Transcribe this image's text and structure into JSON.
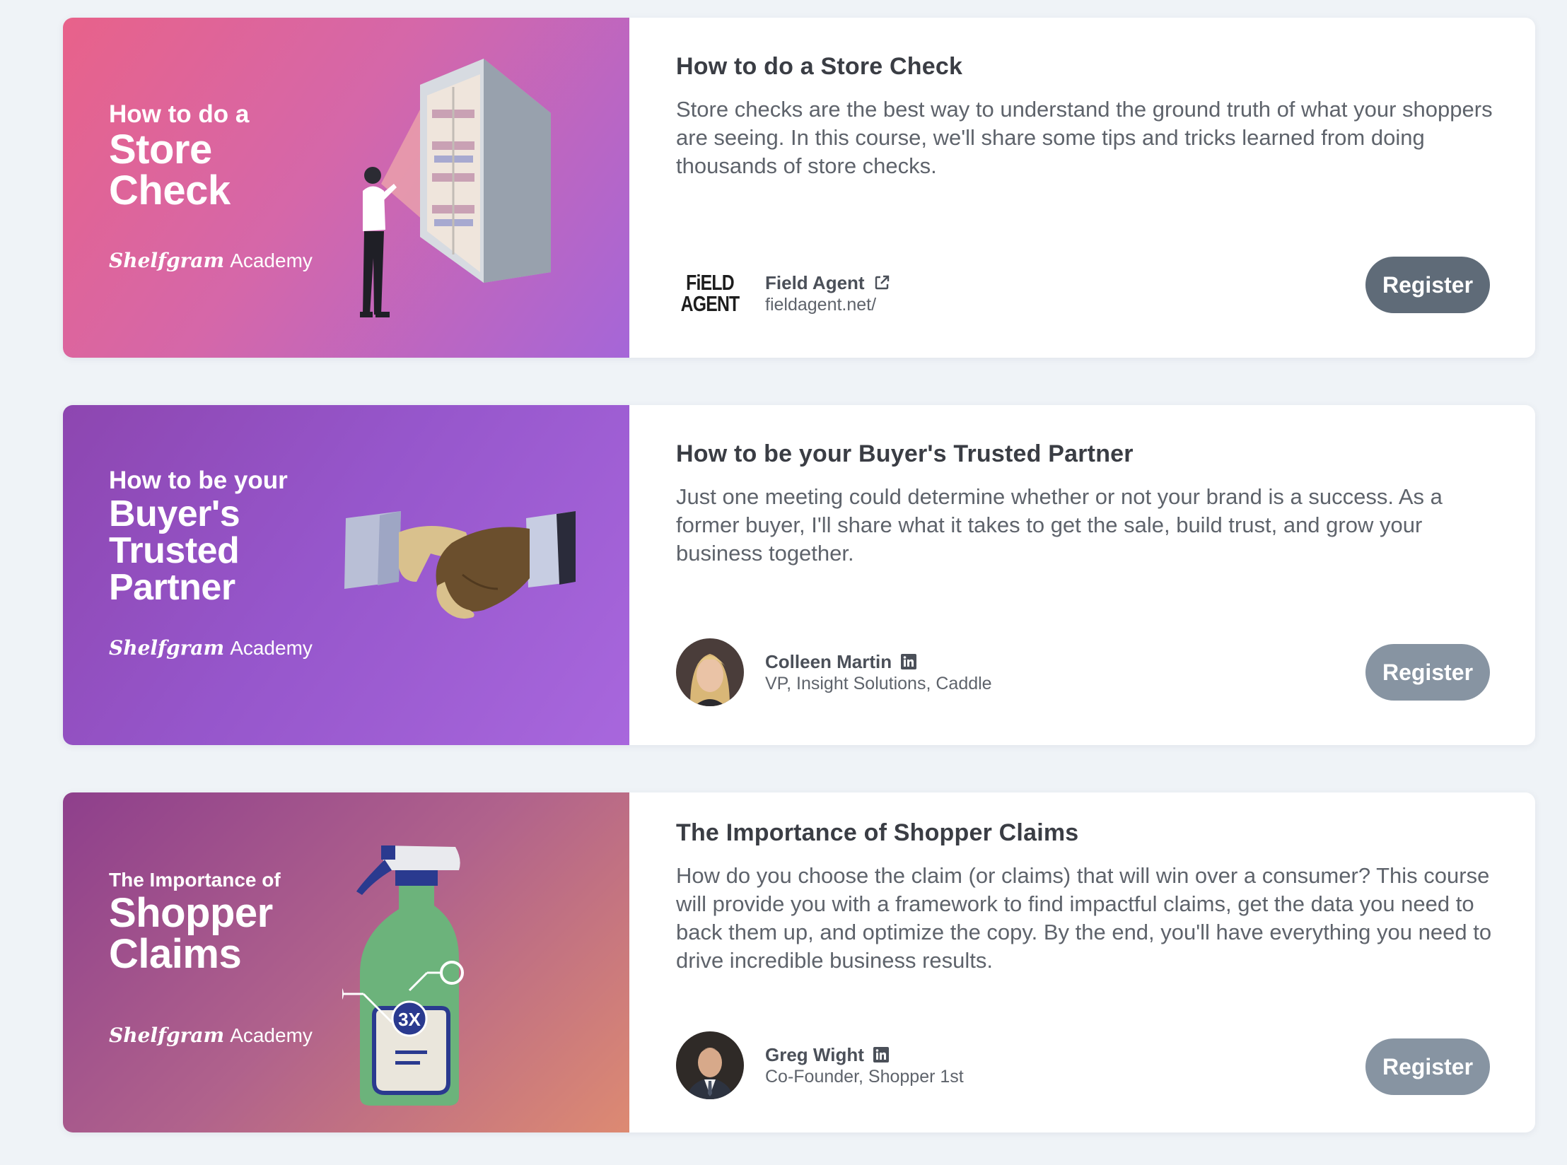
{
  "courses": [
    {
      "thumb": {
        "small_line": "How to do a",
        "big_line_1": "Store",
        "big_line_2": "Check",
        "big_line_3": "",
        "academy_brand": "Shelfgram",
        "academy_word": "Academy"
      },
      "title": "How to do a Store Check",
      "description": "Store checks are the best way to understand the ground truth of what your shoppers are seeing. In this course, we'll share some tips and tricks learned from doing thousands of store checks.",
      "presenter": {
        "logo_line_1": "FiELD",
        "logo_line_2": "AGENT",
        "name": "Field Agent",
        "name_icon": "external-link-icon",
        "subtitle": "fieldagent.net/"
      },
      "register_label": "Register"
    },
    {
      "thumb": {
        "small_line": "How to be your",
        "big_line_1": "Buyer's",
        "big_line_2": "Trusted",
        "big_line_3": "Partner",
        "academy_brand": "Shelfgram",
        "academy_word": "Academy"
      },
      "title": "How to be your Buyer's Trusted Partner",
      "description": "Just one meeting could determine whether or not your brand is a success. As a former buyer, I'll share what it takes to get the sale, build trust, and grow your business together.",
      "presenter": {
        "name": "Colleen Martin",
        "name_icon": "linkedin-icon",
        "subtitle": "VP, Insight Solutions, Caddle"
      },
      "register_label": "Register"
    },
    {
      "thumb": {
        "small_line": "The Importance of",
        "big_line_1": "Shopper",
        "big_line_2": "Claims",
        "big_line_3": "",
        "badge": "3X",
        "academy_brand": "Shelfgram",
        "academy_word": "Academy"
      },
      "title": "The Importance of Shopper Claims",
      "description": "How do you choose the claim (or claims) that will win over a consumer? This course will provide you with a framework to find impactful claims, get the data you need to back them up, and optimize the copy. By the end, you'll have everything you need to drive incredible business results.",
      "presenter": {
        "name": "Greg Wight",
        "name_icon": "linkedin-icon",
        "subtitle": "Co-Founder, Shopper 1st"
      },
      "register_label": "Register"
    }
  ],
  "colors": {
    "page_bg": "#eff3f7",
    "register_active": "#5f6b78",
    "register_muted": "#8794a2"
  }
}
